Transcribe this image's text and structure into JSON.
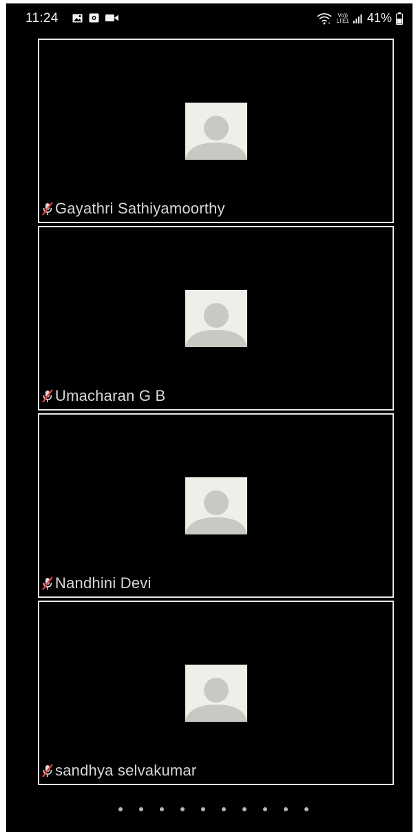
{
  "status_bar": {
    "time": "11:24",
    "left_icons": [
      "image-icon",
      "screen-record-icon",
      "video-camera-icon"
    ],
    "network_label_top": "Vo))",
    "network_label_bottom": "LTE1",
    "battery_percent": "41%"
  },
  "participants": [
    {
      "name": "Gayathri Sathiyamoorthy",
      "muted": true
    },
    {
      "name": "Umacharan G B",
      "muted": true
    },
    {
      "name": "Nandhini Devi",
      "muted": true
    },
    {
      "name": "sandhya selvakumar",
      "muted": true
    }
  ],
  "pagination": {
    "page_count": 10
  },
  "colors": {
    "background": "#000000",
    "tile_border": "#e8e8e8",
    "avatar_bg": "#efefe9",
    "avatar_silhouette": "#c9c8c2",
    "mute_icon": "#e23b3b"
  }
}
